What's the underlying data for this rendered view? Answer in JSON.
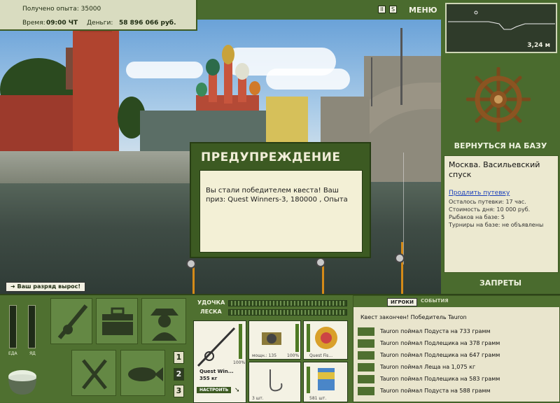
{
  "status": {
    "exp_label": "Получено опыта:",
    "exp_value": "35000",
    "time_label": "Время:",
    "time_value": "09:00 ЧТ",
    "money_label": "Деньги:",
    "money_value": "58 896 066 руб."
  },
  "top_icons": {
    "pause_label": "II",
    "sound_label": "S",
    "menu_label": "МЕНЮ"
  },
  "depth": {
    "value": "3,24 м"
  },
  "dialog": {
    "title": "ПРЕДУПРЕЖДЕНИЕ",
    "message": "Вы стали победителем квеста! Ваш приз: Quest Winners-3, 180000 , Опыта"
  },
  "rank_badge": "Ваш разряд вырос!",
  "right": {
    "return_label": "ВЕРНУТЬСЯ НА БАЗУ",
    "location": "Москва. Васильевский спуск",
    "extend_link": "Продлить путевку",
    "lines": [
      "Осталось путевки: 17 час.",
      "Стоимость дня: 10 000 руб.",
      "Рыбаков на базе: 5",
      "Турниры на базе: не объявлены"
    ],
    "ban_label": "ЗАПРЕТЫ"
  },
  "vitals": {
    "food_label": "ЕДА",
    "poison_label": "ЯД",
    "food_level": 0.0,
    "poison_level": 0.0
  },
  "page_buttons": [
    "1",
    "2",
    "3"
  ],
  "tackle": {
    "rod_label": "УДОЧКА",
    "line_label": "ЛЕСКА",
    "rod_name": "Quest Win...",
    "rod_weight": "355 кг",
    "rod_percent": "100%",
    "reel_caption": "мощн.: 135",
    "reel_percent": "100%",
    "line_caption": "Quest Fis...",
    "hook_count": "3 шт.",
    "bait_count": "581 шт.",
    "adjust_label": "НАСТРОИТЬ"
  },
  "events": {
    "tab_players": "ИГРОКИ",
    "tab_events": "СОБЫТИЯ",
    "header": "Квест закончен! Победитель Tauron",
    "items": [
      "Tauron поймал Подуста на 733 грамм",
      "Tauron поймал Подлещика на 378 грамм",
      "Tauron поймал Подлещика на 647 грамм",
      "Tauron поймал Леща на 1,075 кг",
      "Tauron поймал Подлещика на 583 грамм",
      "Tauron поймал Подуста на 588 грамм"
    ]
  }
}
